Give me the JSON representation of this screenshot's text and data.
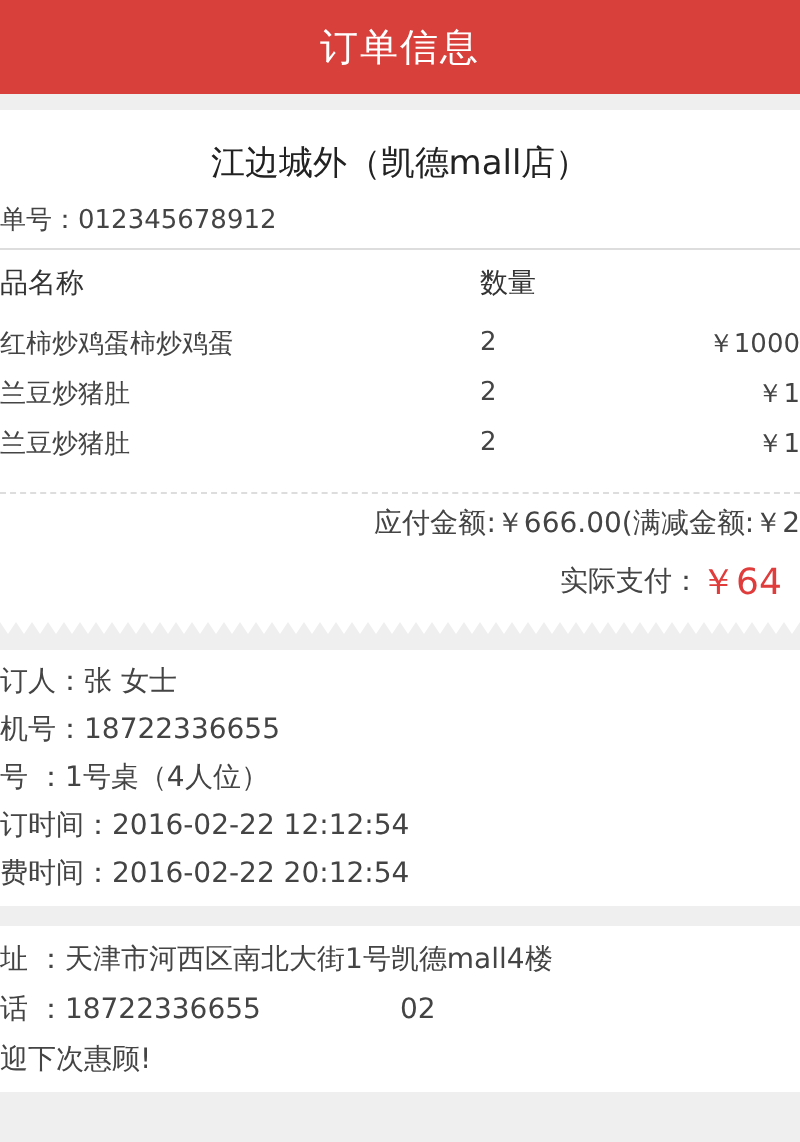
{
  "header": {
    "title": "订单信息"
  },
  "order": {
    "store": "江边城外（凯德mall店）",
    "order_no": "单号：012345678912",
    "columns": [
      "品名称",
      "数量"
    ],
    "items": [
      {
        "name": "红柿炒鸡蛋柿炒鸡蛋",
        "qty": "2",
        "price": "￥1000"
      },
      {
        "name": "兰豆炒猪肚",
        "qty": "2",
        "price": "￥1"
      },
      {
        "name": "兰豆炒猪肚",
        "qty": "2",
        "price": "￥1"
      }
    ],
    "payable": "应付金额:￥666.00(满减金额:￥2",
    "paid_label": "实际支付：",
    "paid_value": "￥64"
  },
  "booking": [
    "订人：张 女士",
    "机号：18722336655",
    "号 ：1号桌（4人位）",
    "订时间：2016-02-22  12:12:54",
    "费时间：2016-02-22  20:12:54"
  ],
  "shop": {
    "address": "址 ：天津市河西区南北大街1号凯德mall4楼",
    "phone": "话 ：18722336655",
    "phone_2": "02",
    "farewell": "迎下次惠顾!"
  }
}
